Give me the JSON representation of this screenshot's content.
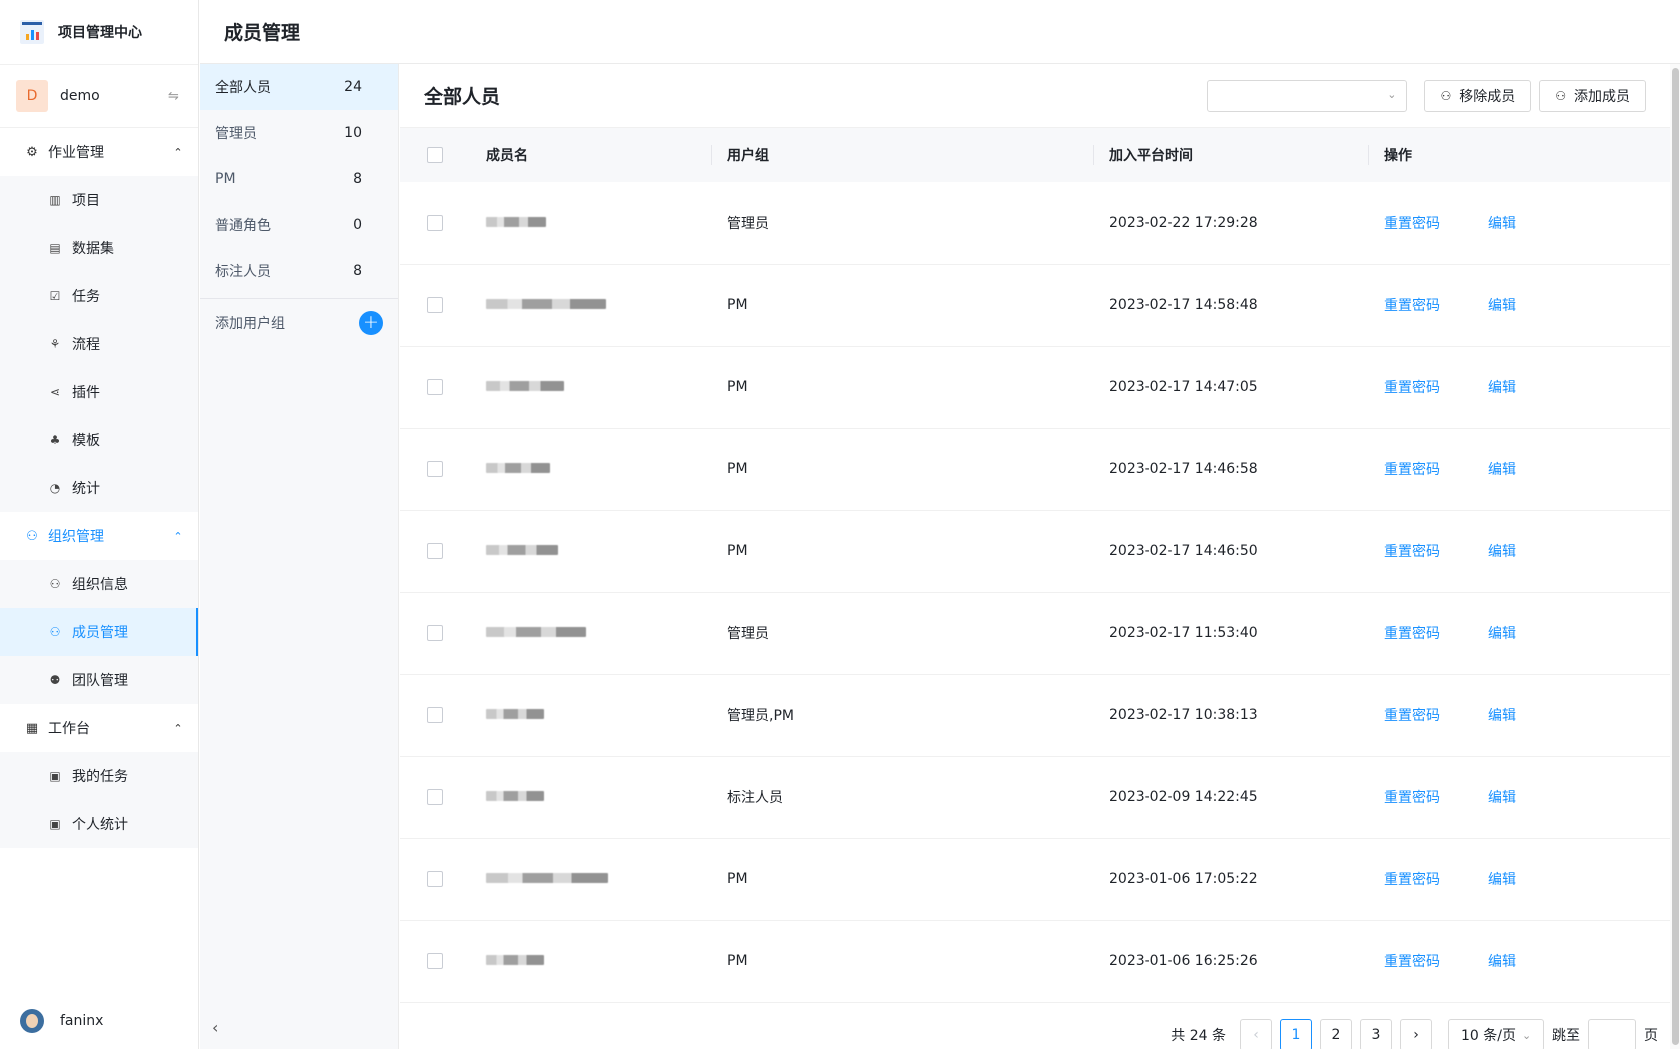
{
  "app": {
    "name": "项目管理中心"
  },
  "user": {
    "initial": "D",
    "name": "demo",
    "bottom_name": "faninx"
  },
  "menu": [
    {
      "label": "作业管理",
      "icon": "⚙",
      "name": "menu-job-management",
      "active": false,
      "items": [
        {
          "label": "项目",
          "icon": "▥",
          "name": "project"
        },
        {
          "label": "数据集",
          "icon": "▤",
          "name": "dataset"
        },
        {
          "label": "任务",
          "icon": "☑",
          "name": "task"
        },
        {
          "label": "流程",
          "icon": "⚘",
          "name": "workflow"
        },
        {
          "label": "插件",
          "icon": "⋖",
          "name": "plugin"
        },
        {
          "label": "模板",
          "icon": "♣",
          "name": "template"
        },
        {
          "label": "统计",
          "icon": "◔",
          "name": "statistics"
        }
      ]
    },
    {
      "label": "组织管理",
      "icon": "⚇",
      "name": "menu-org-management",
      "active": true,
      "items": [
        {
          "label": "组织信息",
          "icon": "⚇",
          "name": "org-info"
        },
        {
          "label": "成员管理",
          "icon": "⚇",
          "name": "member-management",
          "active": true
        },
        {
          "label": "团队管理",
          "icon": "⚉",
          "name": "team-management"
        }
      ]
    },
    {
      "label": "工作台",
      "icon": "▦",
      "name": "menu-workbench",
      "active": false,
      "items": [
        {
          "label": "我的任务",
          "icon": "▣",
          "name": "my-tasks"
        },
        {
          "label": "个人统计",
          "icon": "▣",
          "name": "personal-stats"
        }
      ]
    }
  ],
  "header": {
    "title": "成员管理"
  },
  "groups": [
    {
      "label": "全部人员",
      "count": "24",
      "active": true
    },
    {
      "label": "管理员",
      "count": "10"
    },
    {
      "label": "PM",
      "count": "8"
    },
    {
      "label": "普通角色",
      "count": "0"
    },
    {
      "label": "标注人员",
      "count": "8"
    }
  ],
  "add_group_label": "添加用户组",
  "main": {
    "title": "全部人员",
    "select_value": "",
    "remove_label": "移除成员",
    "add_label": "添加成员"
  },
  "table": {
    "headers": {
      "name": "成员名",
      "group": "用户组",
      "joined": "加入平台时间",
      "ops": "操作"
    },
    "reset_label": "重置密码",
    "edit_label": "编辑",
    "rows": [
      {
        "group": "管理员",
        "joined": "2023-02-22 17:29:28",
        "blur": 60
      },
      {
        "group": "PM",
        "joined": "2023-02-17 14:58:48",
        "blur": 120
      },
      {
        "group": "PM",
        "joined": "2023-02-17 14:47:05",
        "blur": 78
      },
      {
        "group": "PM",
        "joined": "2023-02-17 14:46:58",
        "blur": 64
      },
      {
        "group": "PM",
        "joined": "2023-02-17 14:46:50",
        "blur": 72
      },
      {
        "group": "管理员",
        "joined": "2023-02-17 11:53:40",
        "blur": 100
      },
      {
        "group": "管理员,PM",
        "joined": "2023-02-17 10:38:13",
        "blur": 58
      },
      {
        "group": "标注人员",
        "joined": "2023-02-09 14:22:45",
        "blur": 58
      },
      {
        "group": "PM",
        "joined": "2023-01-06 17:05:22",
        "blur": 122
      },
      {
        "group": "PM",
        "joined": "2023-01-06 16:25:26",
        "blur": 58
      }
    ]
  },
  "pagination": {
    "total_text": "共 24 条",
    "pages": [
      "1",
      "2",
      "3"
    ],
    "current": "1",
    "page_size": "10 条/页",
    "jump_label": "跳至",
    "page_suffix": "页"
  },
  "colors": {
    "accent": "#1890ff",
    "avatar_bg": "#fde2d2",
    "avatar_text": "#e86a2e"
  }
}
